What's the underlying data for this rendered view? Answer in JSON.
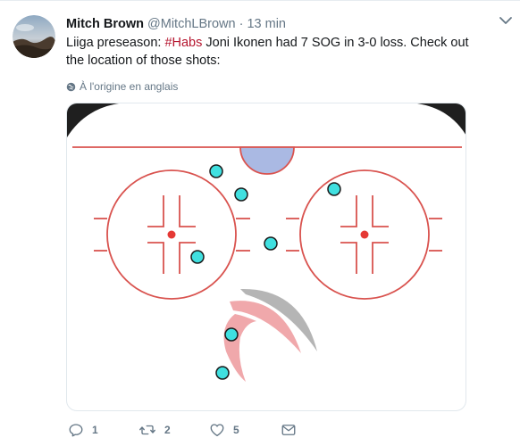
{
  "tweet": {
    "display_name": "Mitch Brown",
    "handle": "@MitchLBrown",
    "separator": "·",
    "timestamp": "13 min",
    "text_before": "Liiga preseason: ",
    "hashtag": "#Habs",
    "text_after": " Joni Ikonen had 7 SOG in 3-0 loss. Check out the location of those shots:",
    "translate_label": "À l'origine en anglais",
    "colors": {
      "hashtag": "#b5152e",
      "muted": "#657786",
      "shot_marker": "#40e0e0",
      "rink_line": "#d9534f"
    }
  },
  "media": {
    "alt": "shot location rink diagram",
    "shots": [
      {
        "label": "shot-1"
      },
      {
        "label": "shot-2"
      },
      {
        "label": "shot-3"
      },
      {
        "label": "shot-4"
      },
      {
        "label": "shot-5"
      },
      {
        "label": "shot-6"
      },
      {
        "label": "shot-7"
      }
    ]
  },
  "actions": {
    "reply_count": "1",
    "retweet_count": "2",
    "like_count": "5",
    "reply_icon": "reply-icon",
    "retweet_icon": "retweet-icon",
    "like_icon": "heart-icon",
    "dm_icon": "envelope-icon"
  }
}
